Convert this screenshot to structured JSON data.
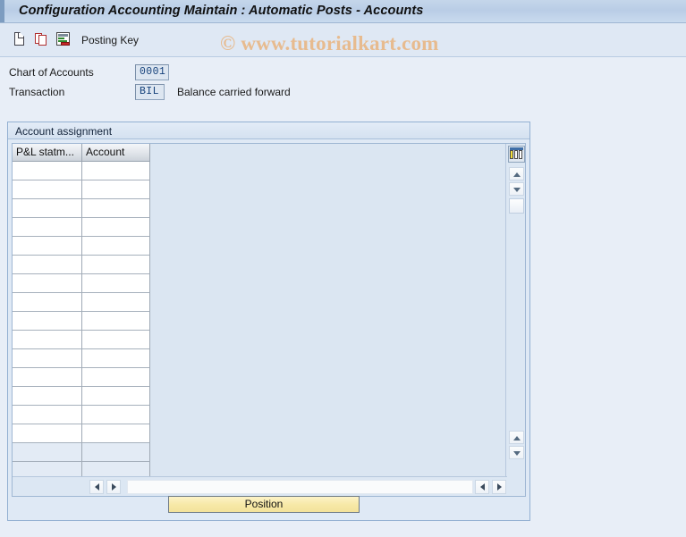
{
  "window": {
    "title": "Configuration Accounting Maintain : Automatic Posts - Accounts"
  },
  "toolbar": {
    "icons": [
      {
        "name": "new-document-icon",
        "glyph": "document"
      },
      {
        "name": "copy-icon",
        "glyph": "copy"
      },
      {
        "name": "list-report-icon",
        "glyph": "list"
      }
    ],
    "posting_key_label": "Posting Key"
  },
  "watermark": {
    "text": "© www.tutorialkart.com",
    "color": "#e8b98a"
  },
  "form": {
    "chart_of_accounts": {
      "label": "Chart of Accounts",
      "value": "0001"
    },
    "transaction": {
      "label": "Transaction",
      "value": "BIL",
      "description": "Balance carried forward"
    }
  },
  "group": {
    "title": "Account assignment"
  },
  "table": {
    "columns": [
      {
        "key": "pl_statement",
        "label": "P&L statm..."
      },
      {
        "key": "account",
        "label": "Account"
      }
    ],
    "rows": [
      {
        "pl_statement": "",
        "account": "",
        "shaded": false
      },
      {
        "pl_statement": "",
        "account": "",
        "shaded": false
      },
      {
        "pl_statement": "",
        "account": "",
        "shaded": false
      },
      {
        "pl_statement": "",
        "account": "",
        "shaded": false
      },
      {
        "pl_statement": "",
        "account": "",
        "shaded": false
      },
      {
        "pl_statement": "",
        "account": "",
        "shaded": false
      },
      {
        "pl_statement": "",
        "account": "",
        "shaded": false
      },
      {
        "pl_statement": "",
        "account": "",
        "shaded": false
      },
      {
        "pl_statement": "",
        "account": "",
        "shaded": false
      },
      {
        "pl_statement": "",
        "account": "",
        "shaded": false
      },
      {
        "pl_statement": "",
        "account": "",
        "shaded": false
      },
      {
        "pl_statement": "",
        "account": "",
        "shaded": false
      },
      {
        "pl_statement": "",
        "account": "",
        "shaded": false
      },
      {
        "pl_statement": "",
        "account": "",
        "shaded": false
      },
      {
        "pl_statement": "",
        "account": "",
        "shaded": false
      },
      {
        "pl_statement": "",
        "account": "",
        "shaded": true
      },
      {
        "pl_statement": "",
        "account": "",
        "shaded": true
      }
    ],
    "config_icon": "table-settings-icon",
    "vertical_scroll": {
      "up_icon": "scroll-up-icon",
      "down_icon": "scroll-down-icon",
      "thumb": "vertical-scroll-thumb",
      "page_up_icon": "scroll-page-up-icon",
      "page_down_icon": "scroll-page-down-icon"
    },
    "horizontal_scroll": {
      "left_icon": "scroll-left-icon",
      "right_icon": "scroll-right-icon",
      "far_left_icon": "scroll-far-left-icon",
      "far_right_icon": "scroll-far-right-icon"
    }
  },
  "footer": {
    "position_button": "Position"
  },
  "colors": {
    "page_background": "#e8eef7",
    "title_bar": "#bfd1e8",
    "toolbar": "#dfe8f4",
    "panel": "#dfe9f5",
    "grid_row": "#ffffff",
    "grid_row_shaded": "#e3ebf5",
    "field_value_text": "#14407a",
    "button_yellow": "#f7e9a8"
  }
}
